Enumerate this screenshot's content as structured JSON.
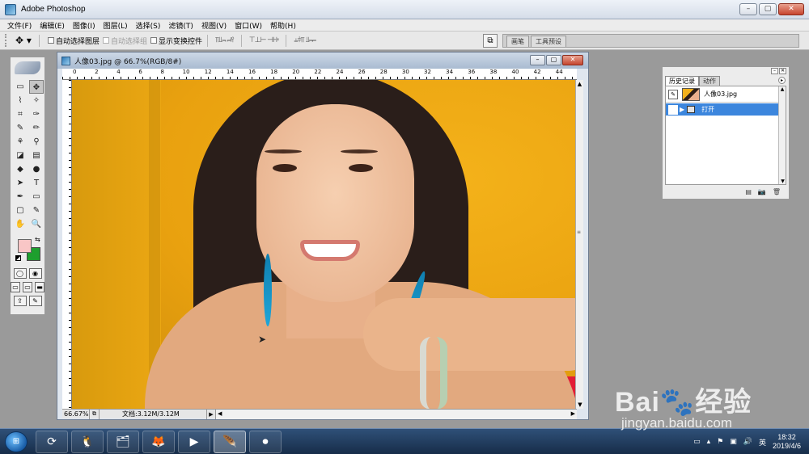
{
  "app": {
    "title": "Adobe Photoshop",
    "window_buttons": {
      "minimize": "–",
      "restore": "▢",
      "close": "✕"
    }
  },
  "menu": [
    "文件(F)",
    "编辑(E)",
    "图像(I)",
    "图层(L)",
    "选择(S)",
    "滤镜(T)",
    "视图(V)",
    "窗口(W)",
    "帮助(H)"
  ],
  "options": {
    "tool_icon": "move-tool",
    "tool_glyph": "✥ ▾",
    "auto_select_layer": "自动选择图层",
    "auto_select_group": "自动选择组",
    "show_transform": "显示变换控件",
    "align_group_1": "⫪⫫⫬ ⫭⫮⫯",
    "align_group_2": "⊤⊥⊢ ⊣⊦⊧",
    "align_group_3": "⫨⫩⫪ ⫫⫬⫭",
    "well_tabs": [
      "画笔",
      "工具预设"
    ]
  },
  "toolbox": {
    "tools": [
      "▭",
      "✥",
      "⌇",
      "✧",
      "⌗",
      "✑",
      "✎",
      "✏",
      "⚘",
      "⚲",
      "◪",
      "▤",
      "◆",
      "●",
      "➤",
      "T",
      "✒",
      "▭",
      "▢",
      "✎",
      "✋",
      "🔍"
    ],
    "foreground_color": "#f9c6c6",
    "background_color": "#1e9f2e"
  },
  "document": {
    "title": "人像03.jpg @ 66.7%(RGB/8#)",
    "zoom": "66.67%",
    "doc_info": "文档:3.12M/3.12M",
    "ruler_top": [
      "0",
      "2",
      "4",
      "6",
      "8",
      "10",
      "12",
      "14",
      "16",
      "18",
      "20",
      "22",
      "24",
      "26",
      "28",
      "30",
      "32",
      "34",
      "36",
      "38",
      "40",
      "42",
      "44"
    ]
  },
  "history": {
    "tabs": [
      "历史记录",
      "动作"
    ],
    "snapshot_label": "人像03.jpg",
    "state_label": "打开"
  },
  "taskbar": {
    "items": [
      "⟳",
      "🐧",
      "🗂",
      "🦊",
      "▶",
      "🪶",
      "⏺"
    ],
    "time": "18:32",
    "date": "2019/4/6",
    "tray_icons": [
      "▭",
      "▴",
      "⚑",
      "▣",
      "🔊",
      "英"
    ]
  },
  "watermark": {
    "logo": "Bai🐾经验",
    "url": "jingyan.baidu.com"
  }
}
